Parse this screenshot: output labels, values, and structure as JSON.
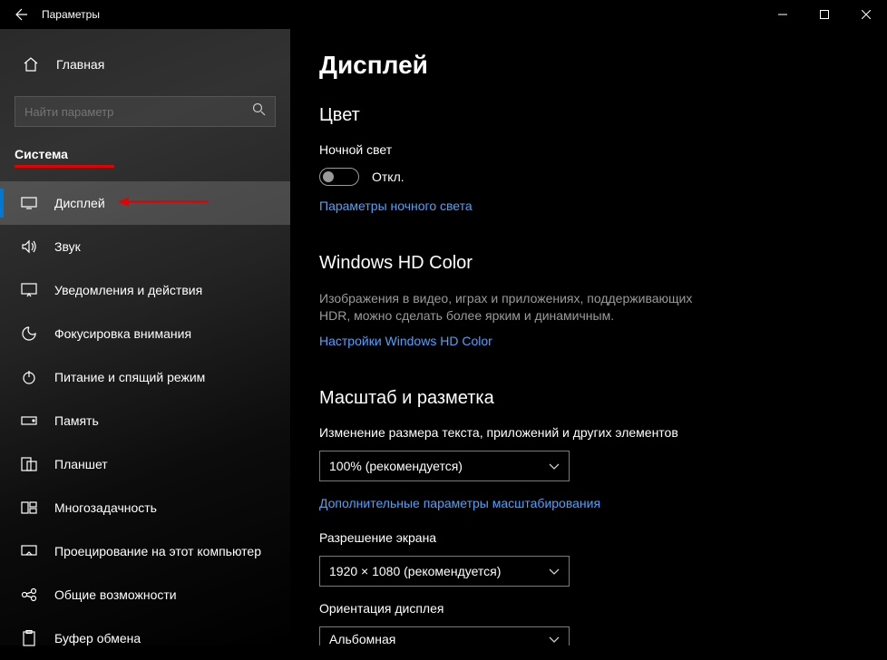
{
  "titlebar": {
    "title": "Параметры"
  },
  "sidebar": {
    "home": "Главная",
    "search_placeholder": "Найти параметр",
    "group": "Система",
    "items": [
      {
        "label": "Дисплей"
      },
      {
        "label": "Звук"
      },
      {
        "label": "Уведомления и действия"
      },
      {
        "label": "Фокусировка внимания"
      },
      {
        "label": "Питание и спящий режим"
      },
      {
        "label": "Память"
      },
      {
        "label": "Планшет"
      },
      {
        "label": "Многозадачность"
      },
      {
        "label": "Проецирование на этот компьютер"
      },
      {
        "label": "Общие возможности"
      },
      {
        "label": "Буфер обмена"
      }
    ]
  },
  "main": {
    "title": "Дисплей",
    "color": {
      "heading": "Цвет",
      "nightlight_label": "Ночной свет",
      "toggle_state": "Откл.",
      "nightlight_link": "Параметры ночного света"
    },
    "hdcolor": {
      "heading": "Windows HD Color",
      "desc": "Изображения в видео, играх и приложениях, поддерживающих HDR, можно сделать более ярким и динамичным.",
      "link": "Настройки Windows HD Color"
    },
    "scale": {
      "heading": "Масштаб и разметка",
      "scale_label": "Изменение размера текста, приложений и других элементов",
      "scale_value": "100% (рекомендуется)",
      "adv_link": "Дополнительные параметры масштабирования",
      "res_label": "Разрешение экрана",
      "res_value": "1920 × 1080 (рекомендуется)",
      "orient_label": "Ориентация дисплея",
      "orient_value": "Альбомная"
    }
  }
}
